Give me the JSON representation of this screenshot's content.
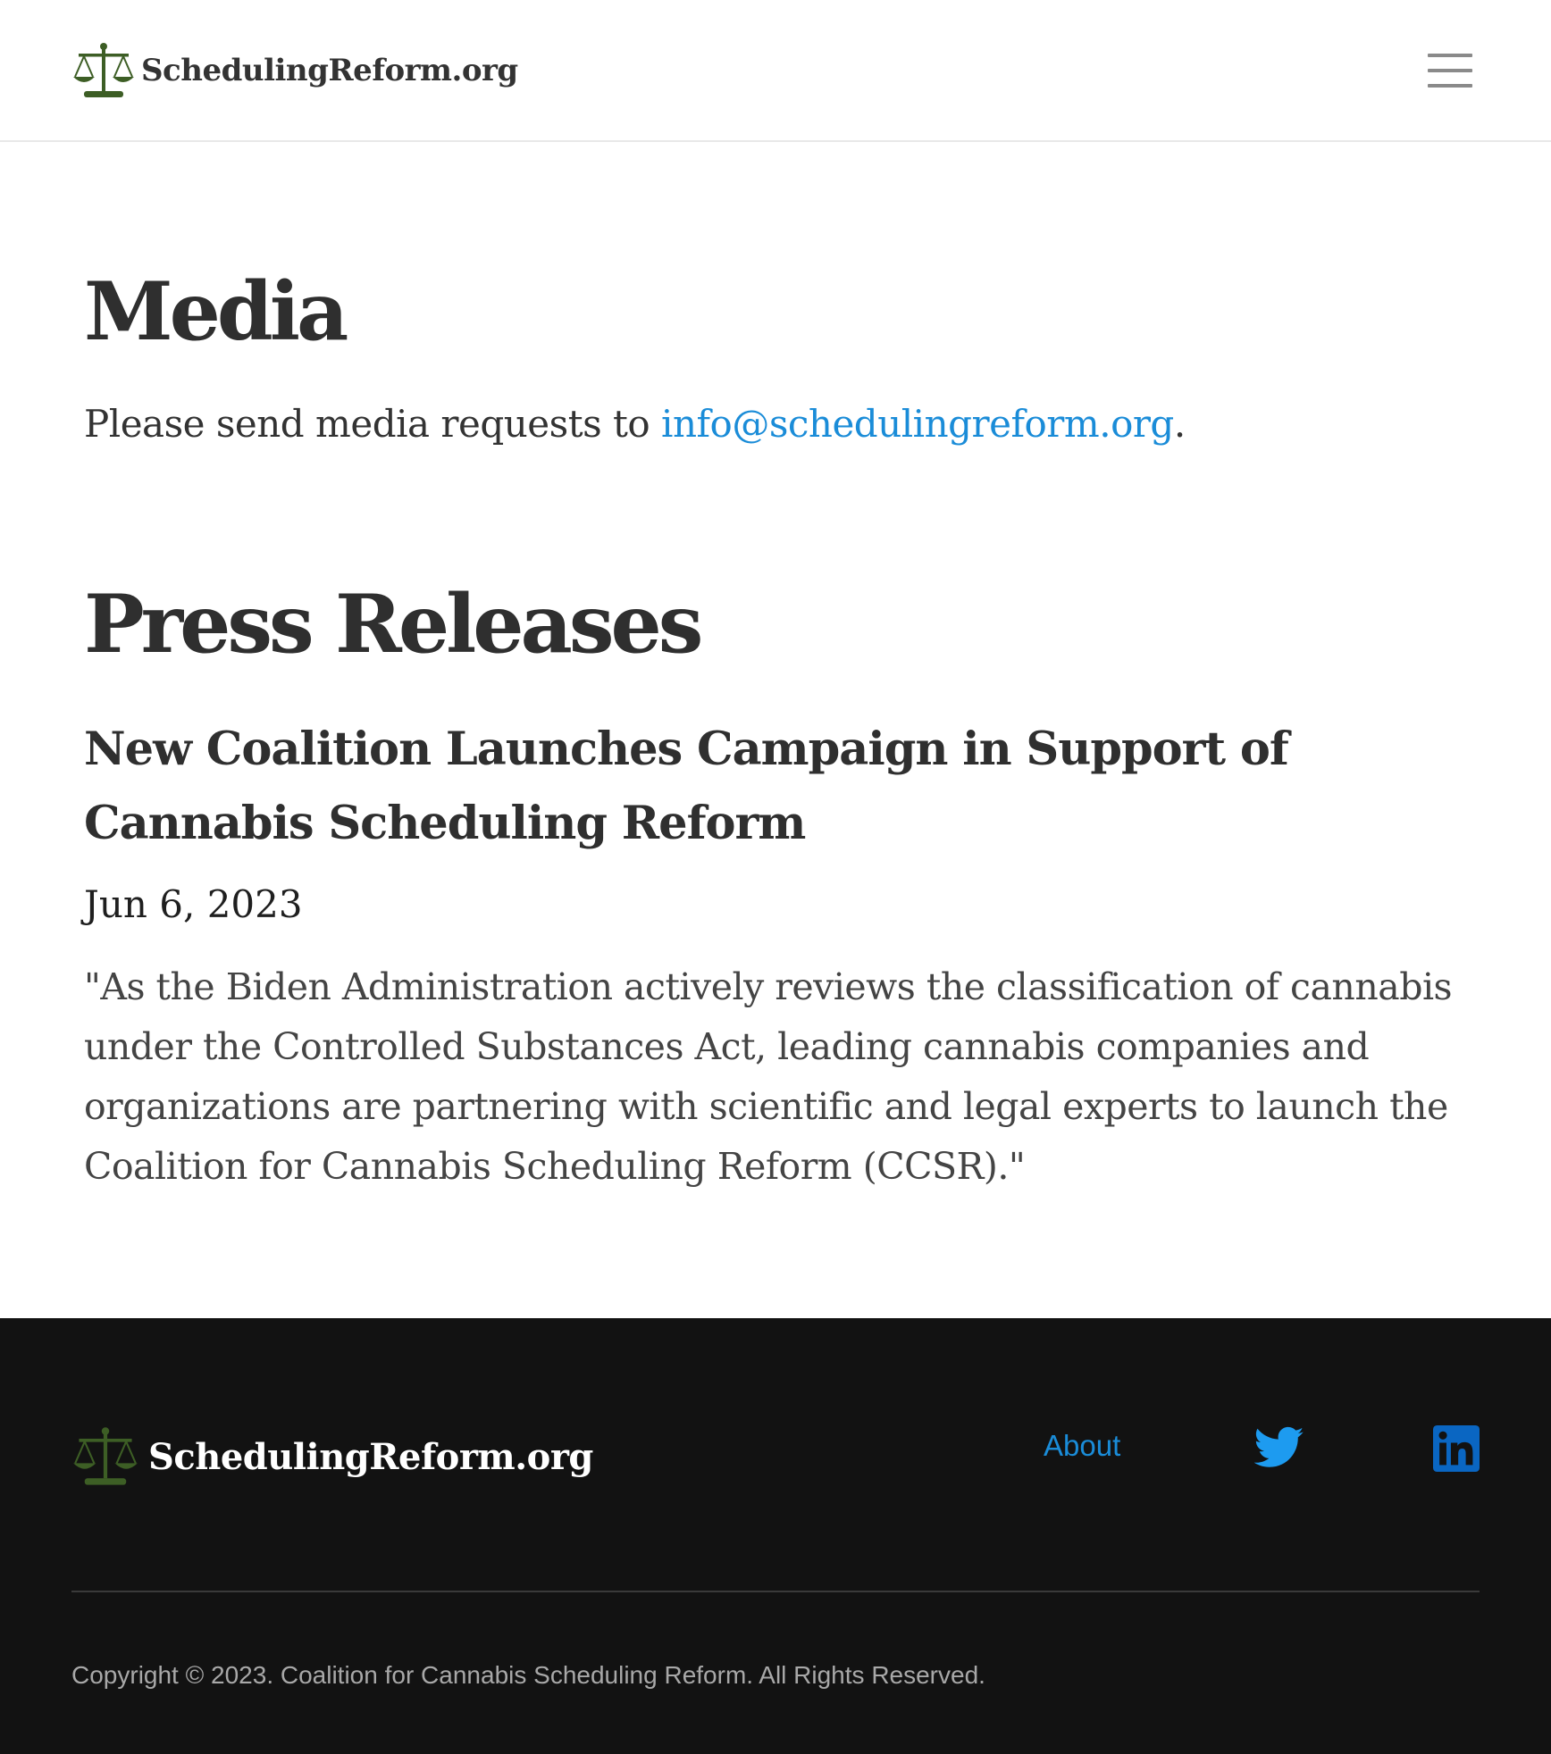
{
  "header": {
    "brand": "SchedulingReform.org",
    "logo_icon": "scales-of-justice-icon",
    "logo_color": "#3d5e25",
    "menu_icon": "hamburger-menu-icon"
  },
  "media": {
    "title": "Media",
    "text_before": "Please send media requests to ",
    "email": "info@schedulingreform.org",
    "text_after": "."
  },
  "press": {
    "title": "Press Releases",
    "releases": [
      {
        "title": "New Coalition Launches Campaign in Support of Cannabis Scheduling Reform",
        "date": "Jun 6, 2023",
        "quote": "\"As the Biden Administration actively reviews the classification of cannabis under the Controlled Substances Act, leading cannabis companies and organizations are partnering with scientific and legal experts to launch the Coalition for Cannabis Scheduling Reform (CCSR).\""
      }
    ]
  },
  "footer": {
    "brand": "SchedulingReform.org",
    "about_label": "About",
    "twitter_icon": "twitter-icon",
    "linkedin_icon": "linkedin-icon",
    "copyright": "Copyright © 2023. Coalition for Cannabis Scheduling Reform. All Rights Reserved.",
    "background": "#121212",
    "link_color": "#1a8cd8",
    "twitter_color": "#1d9bf0",
    "linkedin_color": "#0a66c2"
  }
}
